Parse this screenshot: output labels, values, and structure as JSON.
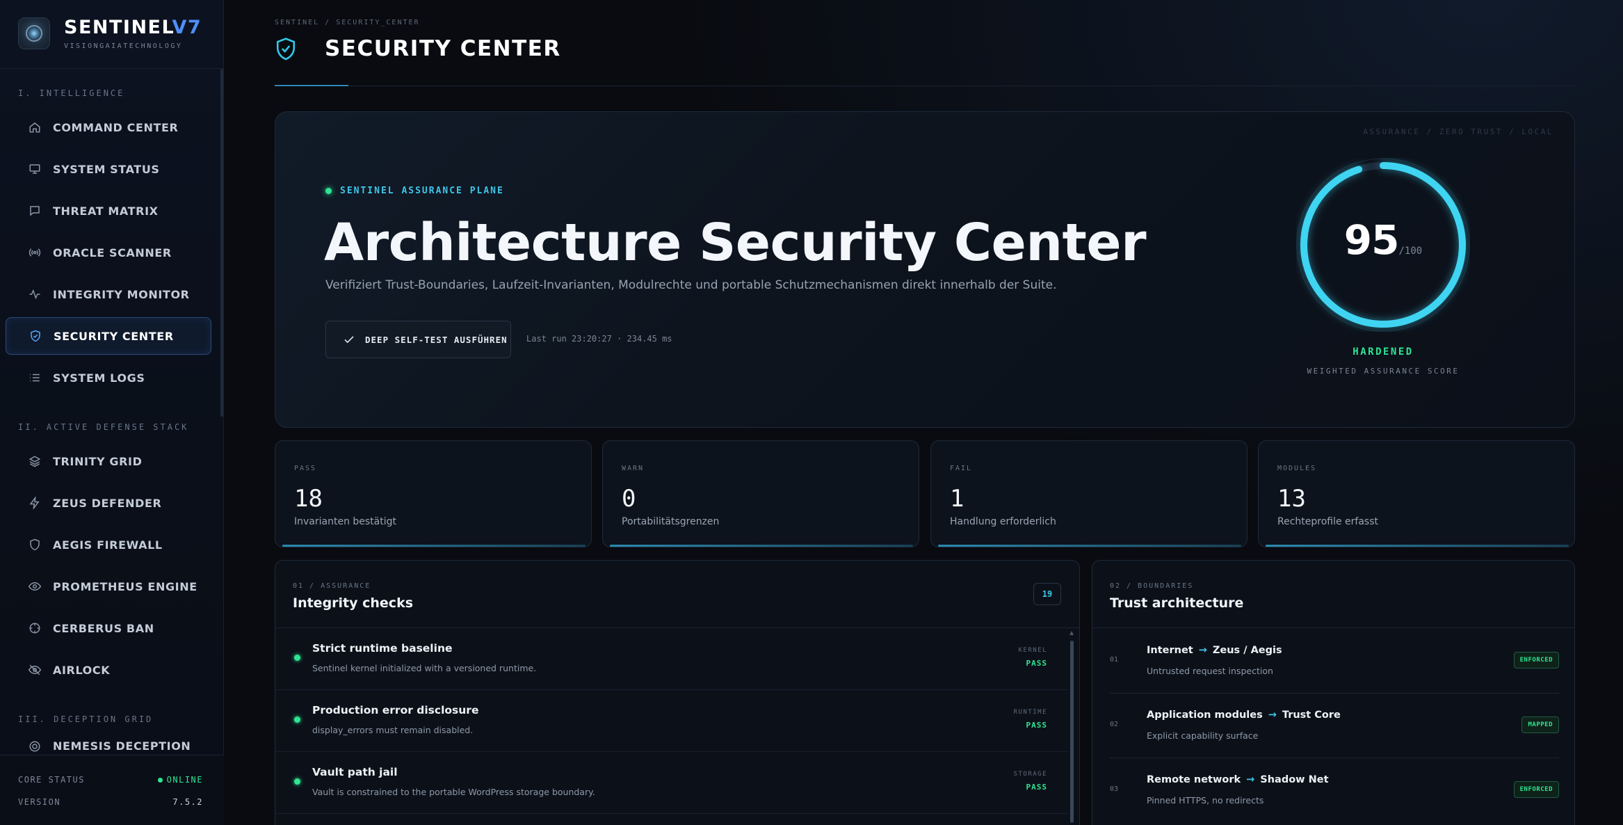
{
  "brand": {
    "title_main": "SENTINEL",
    "title_accent": "V7",
    "subtitle": "VISIONGAIATECHNOLOGY",
    "logo_icon": "sentinel-eye-logo"
  },
  "sidebar": {
    "sections": [
      {
        "label": "I. INTELLIGENCE"
      },
      {
        "label": "II. ACTIVE DEFENSE STACK"
      },
      {
        "label": "III. DECEPTION GRID"
      }
    ],
    "items": [
      {
        "label": "COMMAND CENTER",
        "icon": "home-icon"
      },
      {
        "label": "SYSTEM STATUS",
        "icon": "monitor-icon"
      },
      {
        "label": "THREAT MATRIX",
        "icon": "chat-bubble-icon"
      },
      {
        "label": "ORACLE SCANNER",
        "icon": "radio-waves-icon"
      },
      {
        "label": "INTEGRITY MONITOR",
        "icon": "pulse-icon"
      },
      {
        "label": "SECURITY CENTER",
        "icon": "shield-check-icon",
        "active": true
      },
      {
        "label": "SYSTEM LOGS",
        "icon": "list-icon"
      },
      {
        "label": "TRINITY GRID",
        "icon": "layers-icon"
      },
      {
        "label": "ZEUS DEFENDER",
        "icon": "lightning-icon"
      },
      {
        "label": "AEGIS FIREWALL",
        "icon": "shield-icon"
      },
      {
        "label": "PROMETHEUS ENGINE",
        "icon": "eye-icon"
      },
      {
        "label": "CERBERUS BAN",
        "icon": "crosshair-icon"
      },
      {
        "label": "AIRLOCK",
        "icon": "eye-off-icon"
      },
      {
        "label": "NEMESIS DECEPTION",
        "icon": "target-icon"
      }
    ],
    "footer": {
      "core_status_label": "CORE STATUS",
      "core_status_value": "ONLINE",
      "version_label": "VERSION",
      "version_value": "7.5.2"
    }
  },
  "header": {
    "breadcrumb": "SENTINEL / SECURITY_CENTER",
    "title": "SECURITY CENTER",
    "icon": "shield-check-icon"
  },
  "hero": {
    "corner_label": "ASSURANCE / ZERO TRUST / LOCAL",
    "eyebrow": "SENTINEL ASSURANCE PLANE",
    "title": "Architecture Security Center",
    "description": "Verifiziert Trust-Boundaries, Laufzeit-Invarianten, Modulrechte und portable Schutzmechanismen direkt innerhalb der Suite.",
    "button_label": "DEEP SELF-TEST AUSFÜHREN",
    "last_run": "Last run 23:20:27 · 234.45 ms",
    "score": "95",
    "score_max": "/100",
    "score_fraction": 0.95,
    "status": "HARDENED",
    "score_label": "WEIGHTED ASSURANCE SCORE",
    "accent_color": "#3fd5f2",
    "status_color": "#2ee592"
  },
  "stats": [
    {
      "label": "PASS",
      "value": "18",
      "sub": "Invarianten bestätigt"
    },
    {
      "label": "WARN",
      "value": "0",
      "sub": "Portabilitätsgrenzen"
    },
    {
      "label": "FAIL",
      "value": "1",
      "sub": "Handlung erforderlich"
    },
    {
      "label": "MODULES",
      "value": "13",
      "sub": "Rechteprofile erfasst"
    }
  ],
  "integrity": {
    "eyebrow": "01 / ASSURANCE",
    "title": "Integrity checks",
    "count": "19",
    "checks": [
      {
        "title": "Strict runtime baseline",
        "desc": "Sentinel kernel initialized with a versioned runtime.",
        "category": "KERNEL",
        "result": "PASS"
      },
      {
        "title": "Production error disclosure",
        "desc": "display_errors must remain disabled.",
        "category": "RUNTIME",
        "result": "PASS"
      },
      {
        "title": "Vault path jail",
        "desc": "Vault is constrained to the portable WordPress storage boundary.",
        "category": "STORAGE",
        "result": "PASS"
      }
    ]
  },
  "trust": {
    "eyebrow": "02 / BOUNDARIES",
    "title": "Trust architecture",
    "rows": [
      {
        "index": "01",
        "from": "Internet",
        "arrow": "→",
        "to": "Zeus / Aegis",
        "desc": "Untrusted request inspection",
        "tag": "ENFORCED"
      },
      {
        "index": "02",
        "from": "Application modules",
        "arrow": "→",
        "to": "Trust Core",
        "desc": "Explicit capability surface",
        "tag": "MAPPED"
      },
      {
        "index": "03",
        "from": "Remote network",
        "arrow": "→",
        "to": "Shadow Net",
        "desc": "Pinned HTTPS, no redirects",
        "tag": "ENFORCED"
      }
    ]
  }
}
